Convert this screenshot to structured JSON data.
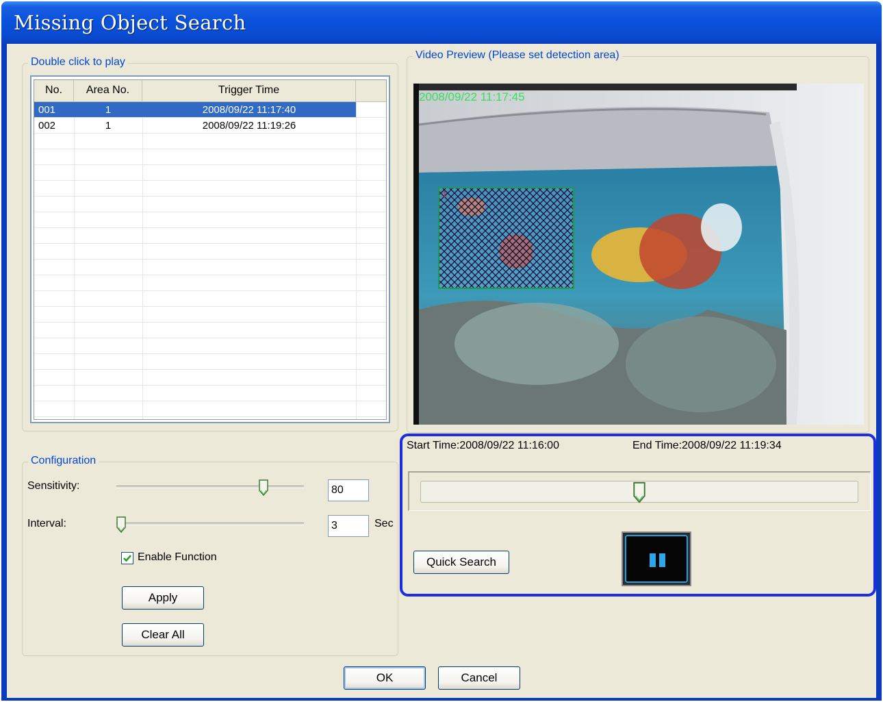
{
  "window": {
    "title": "Missing Object Search"
  },
  "list_group": {
    "legend": "Double click to play",
    "columns": [
      "No.",
      "Area No.",
      "Trigger Time"
    ],
    "rows": [
      {
        "no": "001",
        "area": "1",
        "time": "2008/09/22 11:17:40",
        "selected": true
      },
      {
        "no": "002",
        "area": "1",
        "time": "2008/09/22 11:19:26",
        "selected": false
      }
    ]
  },
  "config_group": {
    "legend": "Configuration",
    "sensitivity_label": "Sensitivity:",
    "sensitivity_value": "80",
    "sensitivity_level": 80,
    "interval_label": "Interval:",
    "interval_value": "3",
    "interval_unit": "Sec",
    "enable_label": "Enable Function",
    "enable_checked": true,
    "apply_label": "Apply",
    "clear_label": "Clear All"
  },
  "video_group": {
    "legend": "Video Preview (Please set detection area)",
    "timestamp": "2008/09/22 11:17:45",
    "area_number": "1"
  },
  "playback": {
    "start_time": "Start Time:2008/09/22 11:16:00",
    "end_time": "End Time:2008/09/22 11:19:34",
    "progress": 0.5,
    "quick_search_label": "Quick Search",
    "pause_icon": "pause-icon"
  },
  "footer": {
    "ok_label": "OK",
    "cancel_label": "Cancel"
  },
  "colors": {
    "accent": "#0046d5",
    "selection": "#316ac5",
    "highlight_border": "#1b2fe0",
    "timestamp": "#37e05a",
    "detection_area": "#0a0a40"
  }
}
